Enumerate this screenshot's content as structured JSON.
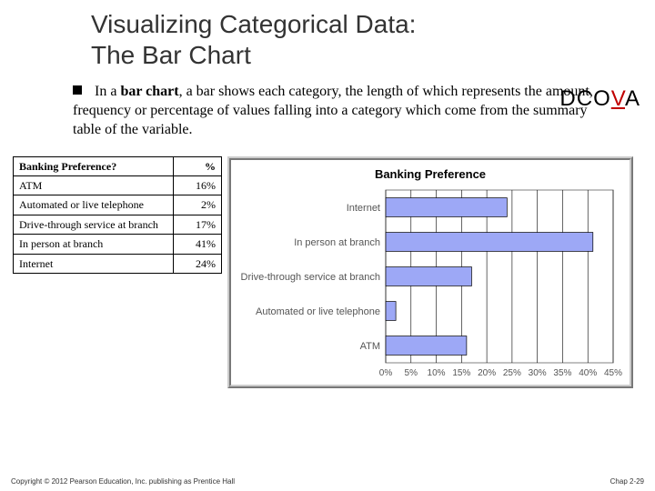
{
  "title_line1": "Visualizing Categorical Data:",
  "title_line2": "The Bar Chart",
  "dcova": {
    "d": "D",
    "c": "C",
    "o": "O",
    "v": "V",
    "a": "A"
  },
  "body": "In a bar chart, a bar shows each category, the length of which represents the amount, frequency or percentage of values falling into a category which come from the summary table of the variable.",
  "body_bold_lead": "bar chart",
  "table": {
    "header_cat": "Banking Preference?",
    "header_pct": "%",
    "rows": [
      {
        "cat": "ATM",
        "pct": "16%"
      },
      {
        "cat": "Automated or live telephone",
        "pct": "2%"
      },
      {
        "cat": "Drive-through service at branch",
        "pct": "17%"
      },
      {
        "cat": "In person at branch",
        "pct": "41%"
      },
      {
        "cat": "Internet",
        "pct": "24%"
      }
    ]
  },
  "chart_data": {
    "type": "bar",
    "orientation": "horizontal",
    "title": "Banking Preference",
    "xlabel": "",
    "ylabel": "",
    "xlim": [
      0,
      45
    ],
    "xticks": [
      "0%",
      "5%",
      "10%",
      "15%",
      "20%",
      "25%",
      "30%",
      "35%",
      "40%",
      "45%"
    ],
    "categories": [
      "Internet",
      "In person at branch",
      "Drive-through service at branch",
      "Automated or live telephone",
      "ATM"
    ],
    "values": [
      24,
      41,
      17,
      2,
      16
    ],
    "bar_color": "#9da8f6"
  },
  "footer": {
    "left": "Copyright © 2012 Pearson Education, Inc. publishing as Prentice Hall",
    "right": "Chap 2-29"
  }
}
